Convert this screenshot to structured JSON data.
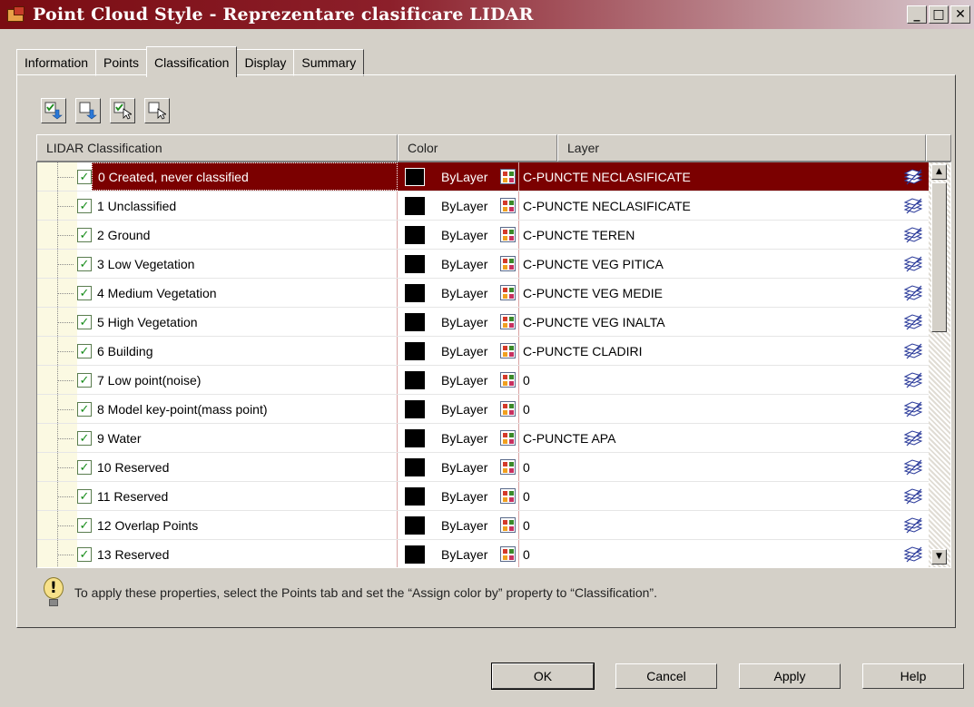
{
  "window": {
    "title": "Point Cloud Style - Reprezentare clasificare LIDAR",
    "buttons": [
      "_",
      "□",
      "✕"
    ]
  },
  "tabs": [
    {
      "label": "Information",
      "active": false
    },
    {
      "label": "Points",
      "active": false
    },
    {
      "label": "Classification",
      "active": true
    },
    {
      "label": "Display",
      "active": false
    },
    {
      "label": "Summary",
      "active": false
    }
  ],
  "toolbar": {
    "icons": [
      "check-all-down-icon",
      "uncheck-all-down-icon",
      "check-selected-icon",
      "uncheck-selected-icon"
    ]
  },
  "grid": {
    "headers": {
      "classification": "LIDAR Classification",
      "color": "Color",
      "layer": "Layer"
    },
    "rows": [
      {
        "name": "0 Created, never classified",
        "color": "ByLayer",
        "layer": "C-PUNCTE NECLASIFICATE",
        "checked": true,
        "selected": true
      },
      {
        "name": "1 Unclassified",
        "color": "ByLayer",
        "layer": "C-PUNCTE NECLASIFICATE",
        "checked": true
      },
      {
        "name": "2 Ground",
        "color": "ByLayer",
        "layer": "C-PUNCTE TEREN",
        "checked": true
      },
      {
        "name": "3 Low Vegetation",
        "color": "ByLayer",
        "layer": "C-PUNCTE VEG PITICA",
        "checked": true
      },
      {
        "name": "4 Medium Vegetation",
        "color": "ByLayer",
        "layer": "C-PUNCTE VEG MEDIE",
        "checked": true
      },
      {
        "name": "5 High Vegetation",
        "color": "ByLayer",
        "layer": "C-PUNCTE VEG INALTA",
        "checked": true
      },
      {
        "name": "6 Building",
        "color": "ByLayer",
        "layer": "C-PUNCTE CLADIRI",
        "checked": true
      },
      {
        "name": "7 Low point(noise)",
        "color": "ByLayer",
        "layer": "0",
        "checked": true
      },
      {
        "name": "8 Model key-point(mass point)",
        "color": "ByLayer",
        "layer": "0",
        "checked": true
      },
      {
        "name": "9 Water",
        "color": "ByLayer",
        "layer": "C-PUNCTE APA",
        "checked": true
      },
      {
        "name": "10 Reserved",
        "color": "ByLayer",
        "layer": "0",
        "checked": true
      },
      {
        "name": "11 Reserved",
        "color": "ByLayer",
        "layer": "0",
        "checked": true
      },
      {
        "name": "12 Overlap Points",
        "color": "ByLayer",
        "layer": "0",
        "checked": true
      },
      {
        "name": "13 Reserved",
        "color": "ByLayer",
        "layer": "0",
        "checked": true
      }
    ]
  },
  "hint": "To apply these properties, select the Points tab and set the “Assign color by” property to “Classification”.",
  "footer": {
    "ok": "OK",
    "cancel": "Cancel",
    "apply": "Apply",
    "help": "Help"
  },
  "colors": {
    "selected_row": "#7b0000",
    "title_bar": "#7a0c12",
    "dialog": "#d4d0c8"
  }
}
